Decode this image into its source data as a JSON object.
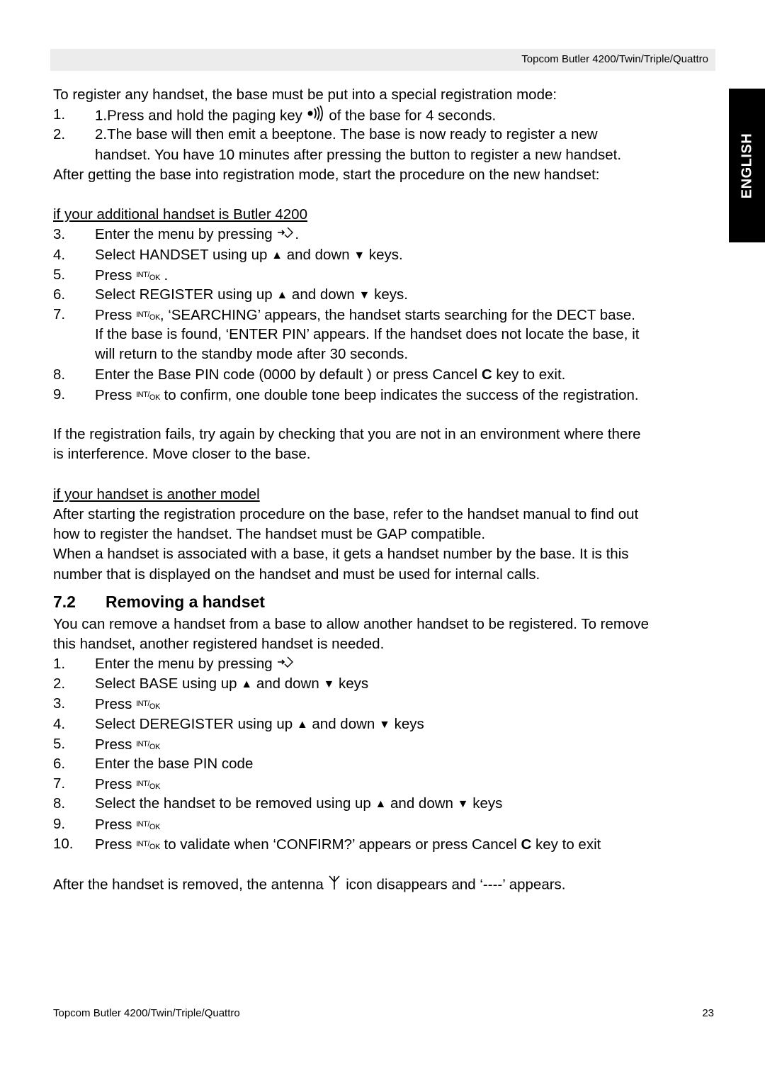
{
  "header": {
    "title": "Topcom Butler 4200/Twin/Triple/Quattro"
  },
  "language_tab": {
    "label": "ENGLISH"
  },
  "intro": "To register any handset, the base must be put into a special registration mode:",
  "base_steps": [
    {
      "num": "1.",
      "pre": "1.Press and hold the paging key",
      "post": "of the base for 4 seconds."
    },
    {
      "num": "2.",
      "line1": "2.The base will then emit a beeptone. The base is now ready to register a new",
      "line2": "handset. You have 10 minutes after pressing the button to register a new handset."
    }
  ],
  "after_base": "After getting the base into registration mode, start the procedure on the new handset:",
  "butler_heading": "if your additional handset is Butler 4200",
  "register_steps": {
    "s3": {
      "num": "3.",
      "pre": "Enter the menu by pressing",
      "post": "."
    },
    "s4": {
      "num": "4.",
      "pre": "Select HANDSET using up",
      "mid": "and down",
      "post": "keys."
    },
    "s5": {
      "num": "5.",
      "pre": "Press",
      "post": "."
    },
    "s6": {
      "num": "6.",
      "pre": "Select REGISTER using up",
      "mid": "and down",
      "post": "keys."
    },
    "s7": {
      "num": "7.",
      "pre": "Press",
      "post": ", ‘SEARCHING’ appears, the handset starts searching for the DECT base.",
      "line2": "If the base is found, ‘ENTER PIN’ appears. If the handset does not locate the base, it",
      "line3": "will return to the standby mode after 30 seconds."
    },
    "s8": {
      "num": "8.",
      "pre": "Enter the Base PIN code (0000 by default ) or press Cancel",
      "bold": "C",
      "post": "key to exit."
    },
    "s9": {
      "num": "9.",
      "pre": "Press",
      "post": "to confirm, one double tone beep indicates the success of the registration."
    }
  },
  "fail_text": {
    "line1": "If the registration fails, try again by checking that you are not in an environment where there",
    "line2": "is interference. Move closer to the base."
  },
  "other_heading": "if your handset is another model",
  "other_text": {
    "line1": "After starting the registration procedure on the base, refer to the handset manual to find out",
    "line2": "how to register the handset. The handset must be GAP compatible.",
    "line3": "When a handset is associated with a base, it gets a handset number by the base. It is this",
    "line4": "number that is displayed on the handset and must be used for internal calls."
  },
  "section": {
    "number": "7.2",
    "title": "Removing a handset"
  },
  "remove_intro": {
    "line1": "You can remove a handset from a base to allow another handset to be registered. To remove",
    "line2": "this handset, another registered handset is needed."
  },
  "remove_steps": {
    "r1": {
      "num": "1.",
      "pre": "Enter the menu by pressing"
    },
    "r2": {
      "num": "2.",
      "pre": "Select BASE using up",
      "mid": "and down",
      "post": "keys"
    },
    "r3": {
      "num": "3.",
      "pre": "Press"
    },
    "r4": {
      "num": "4.",
      "pre": "Select DEREGISTER using up",
      "mid": "and down",
      "post": "keys"
    },
    "r5": {
      "num": "5.",
      "pre": "Press"
    },
    "r6": {
      "num": "6.",
      "pre": "Enter the base PIN code"
    },
    "r7": {
      "num": "7.",
      "pre": "Press"
    },
    "r8": {
      "num": "8.",
      "pre": "Select the handset to be removed using up",
      "mid": "and down",
      "post": "keys"
    },
    "r9": {
      "num": "9.",
      "pre": "Press"
    },
    "r10": {
      "num": "10.",
      "pre": "Press",
      "post": "to validate when ‘CONFIRM?’ appears or press Cancel",
      "bold": "C",
      "post2": "key to exit"
    }
  },
  "final_text": {
    "pre": "After the handset is removed, the antenna",
    "post": "icon disappears and ‘----’ appears."
  },
  "icons": {
    "intok_top": "INT",
    "intok_bottom": "OK",
    "up": "▲",
    "down": "▼"
  },
  "footer": {
    "title": "Topcom Butler 4200/Twin/Triple/Quattro",
    "page": "23"
  }
}
